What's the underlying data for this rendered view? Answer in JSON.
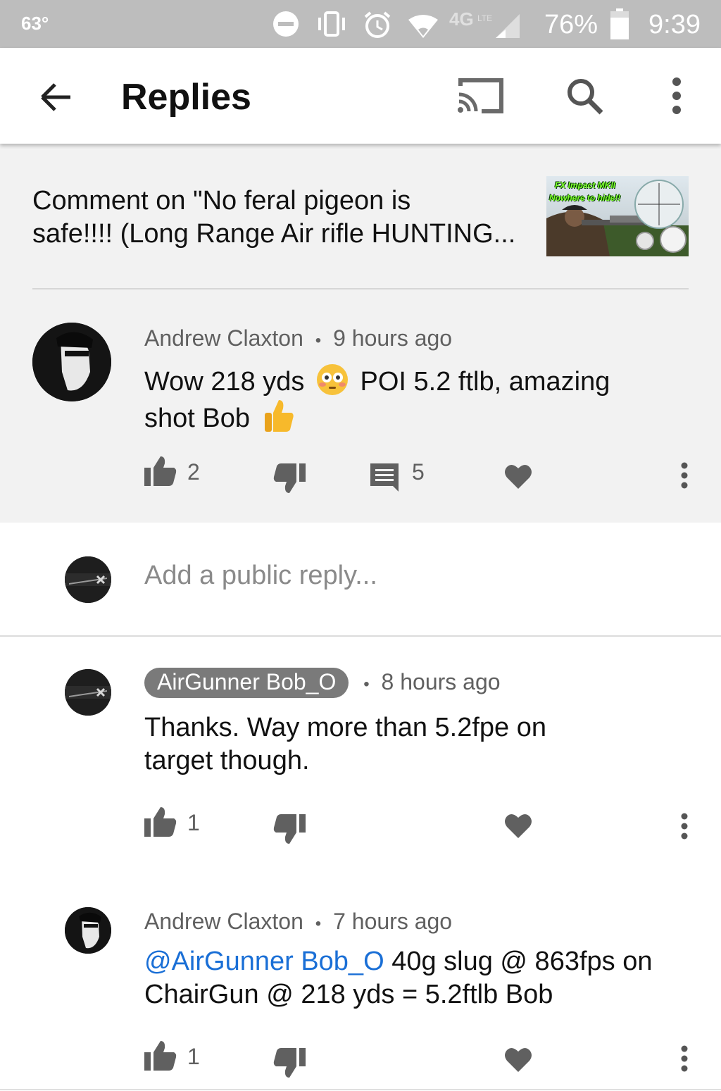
{
  "status_bar": {
    "temperature": "63°",
    "network": "4G LTE",
    "battery": "76%",
    "time": "9:39"
  },
  "app_bar": {
    "title": "Replies",
    "icons": [
      "back-arrow-icon",
      "cast-icon",
      "search-icon",
      "more-vert-icon"
    ]
  },
  "video": {
    "title_line1": "Comment on \"No feral pigeon is",
    "title_line2": "safe!!!! (Long Range Air rifle HUNTING...",
    "thumbnail_line1": "FX Impact MKII",
    "thumbnail_line2": "Nowhere to hide!!"
  },
  "comment": {
    "author": "Andrew Claxton",
    "time": "9 hours ago",
    "text_part1": "Wow 218 yds",
    "text_part2": "POI 5.2 ftlb, amazing",
    "text_line2": "shot Bob",
    "likes": "2",
    "replies": "5"
  },
  "reply_box": {
    "placeholder": "Add a public reply..."
  },
  "replies": [
    {
      "author": "AirGunner Bob_O",
      "time": "8 hours ago",
      "text_line1": "Thanks.  Way more than 5.2fpe on",
      "text_line2": "target though.",
      "likes": "1"
    },
    {
      "author": "Andrew Claxton",
      "time": "7 hours ago",
      "mention": "@AirGunner Bob_O",
      "text_line1_rest": " 40g slug @ 863fps on",
      "text_line2": "ChairGun @ 218 yds = 5.2ftlb Bob",
      "likes": "1"
    }
  ],
  "meta_separator": "•",
  "colors": {
    "status_bar": "#bdbdbd",
    "header_bg": "#f2f2f2",
    "icon_grey": "#606060",
    "mention_blue": "#1a6fd6",
    "author_chip": "#7a7a7a"
  }
}
